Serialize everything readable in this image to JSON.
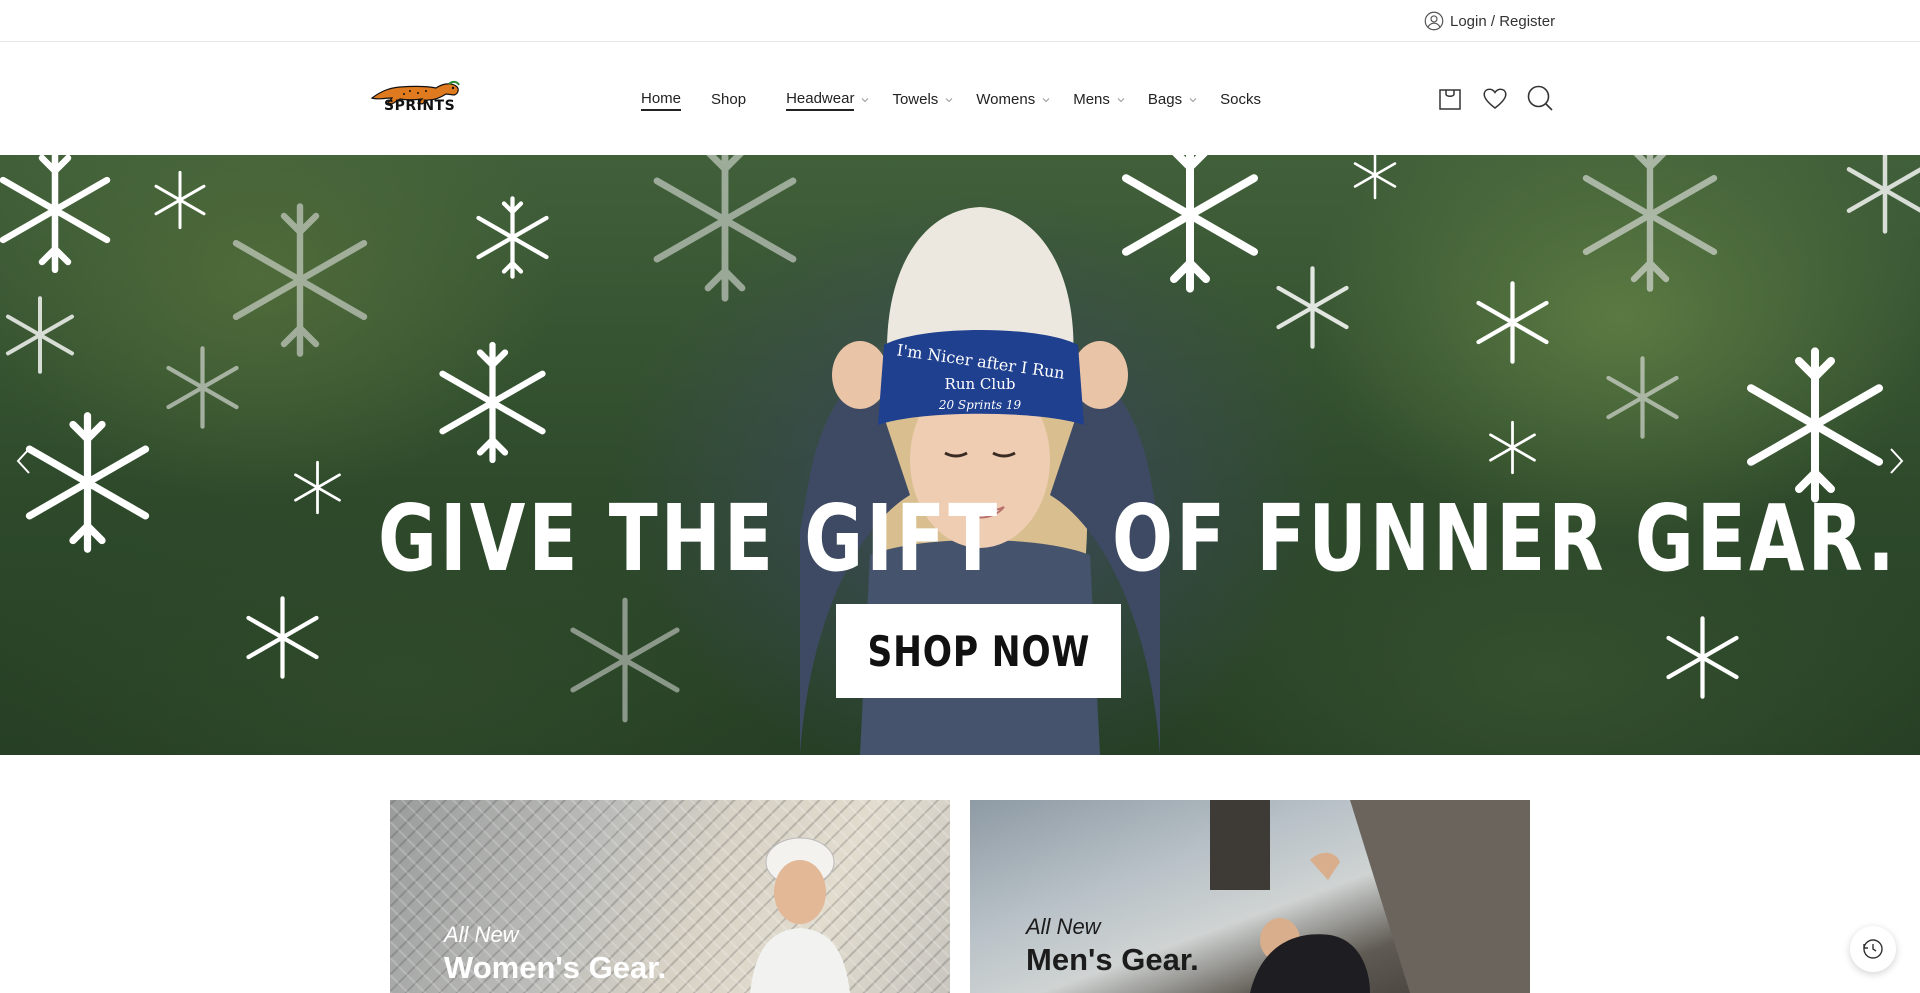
{
  "topbar": {
    "login_label": "Login / Register",
    "login_icon": "user-icon"
  },
  "header": {
    "logo_text": "SPRINTS",
    "nav": [
      {
        "label": "Home",
        "active": true,
        "dropdown": false
      },
      {
        "label": "Shop",
        "active": false,
        "dropdown": false
      },
      {
        "label": "Headwear",
        "active": true,
        "dropdown": true
      },
      {
        "label": "Towels",
        "active": false,
        "dropdown": true
      },
      {
        "label": "Womens",
        "active": false,
        "dropdown": true
      },
      {
        "label": "Mens",
        "active": false,
        "dropdown": true
      },
      {
        "label": "Bags",
        "active": false,
        "dropdown": true
      },
      {
        "label": "Socks",
        "active": false,
        "dropdown": false
      }
    ],
    "icons": [
      "cart-icon",
      "heart-icon",
      "search-icon"
    ]
  },
  "hero": {
    "title_left": "GIVE THE GIFT",
    "title_right": "OF FUNNER GEAR.",
    "beanie_text": [
      "I'm Nicer after I Run",
      "Run Club",
      "20 Sprints 19"
    ],
    "cta_label": "SHOP NOW",
    "colors": {
      "beanie_blue": "#1f3f8f",
      "beanie_cream": "#ece8df",
      "hoodie": "#3e4a63"
    }
  },
  "promos": [
    {
      "sub": "All New",
      "main": "Women's Gear."
    },
    {
      "sub": "All New",
      "main": "Men's Gear."
    }
  ],
  "colors": {
    "text": "#222222",
    "accent": "#e07a1f"
  }
}
